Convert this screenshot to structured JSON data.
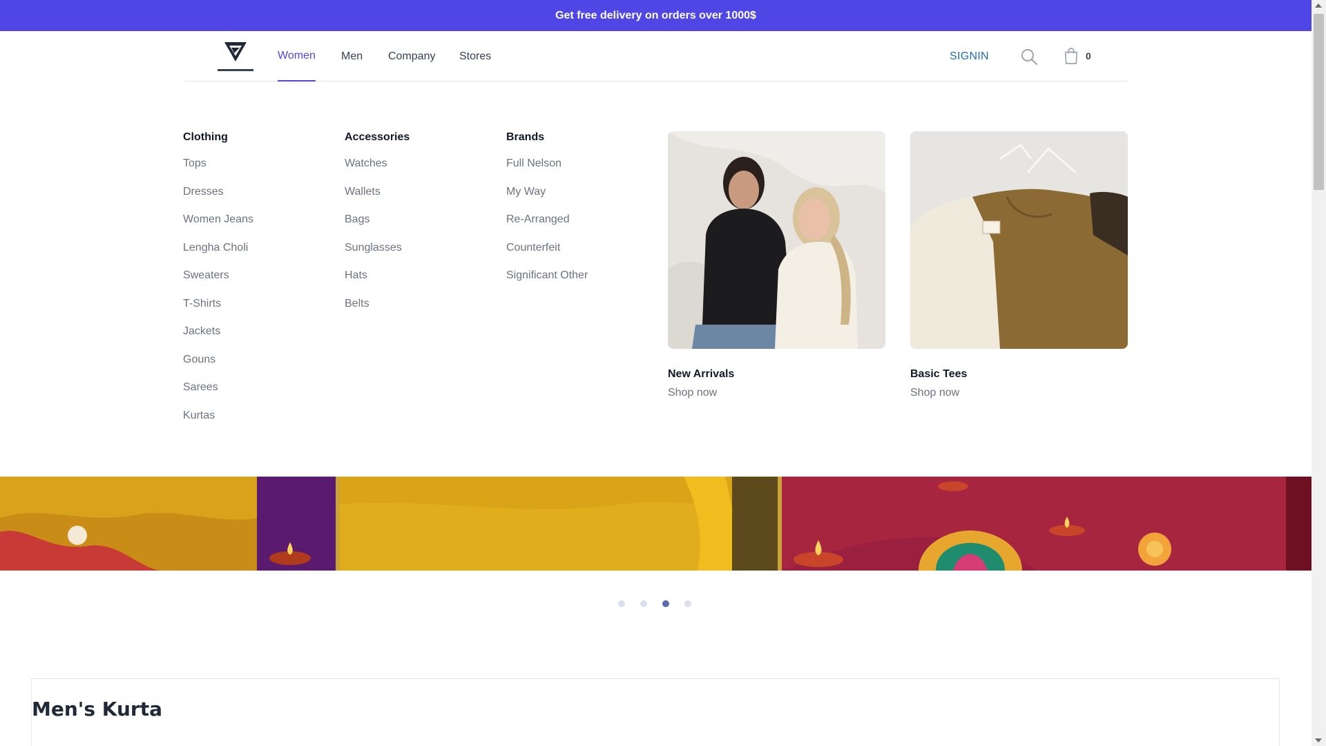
{
  "promo": {
    "text": "Get free delivery on orders over 1000$"
  },
  "nav": {
    "links": [
      "Women",
      "Men",
      "Company",
      "Stores"
    ],
    "active": "Women",
    "signin": "SIGNIN",
    "cart_count": "0"
  },
  "mega_menu": {
    "columns": [
      {
        "heading": "Clothing",
        "items": [
          "Tops",
          "Dresses",
          "Women Jeans",
          "Lengha Choli",
          "Sweaters",
          "T-Shirts",
          "Jackets",
          "Gouns",
          "Sarees",
          "Kurtas"
        ]
      },
      {
        "heading": "Accessories",
        "items": [
          "Watches",
          "Wallets",
          "Bags",
          "Sunglasses",
          "Hats",
          "Belts"
        ]
      },
      {
        "heading": "Brands",
        "items": [
          "Full Nelson",
          "My Way",
          "Re-Arranged",
          "Counterfeit",
          "Significant Other"
        ]
      }
    ],
    "features": [
      {
        "title": "New Arrivals",
        "cta": "Shop now"
      },
      {
        "title": "Basic Tees",
        "cta": "Shop now"
      }
    ]
  },
  "carousel": {
    "slide_count": 4,
    "active_index": 2
  },
  "section": {
    "title": "Men's Kurta"
  },
  "colors": {
    "accent": "#4f46e5",
    "signin": "#1e6fb8",
    "banner_gold": "#d9a21b",
    "banner_red": "#9b1f3f",
    "banner_purple": "#5a1a6e"
  }
}
